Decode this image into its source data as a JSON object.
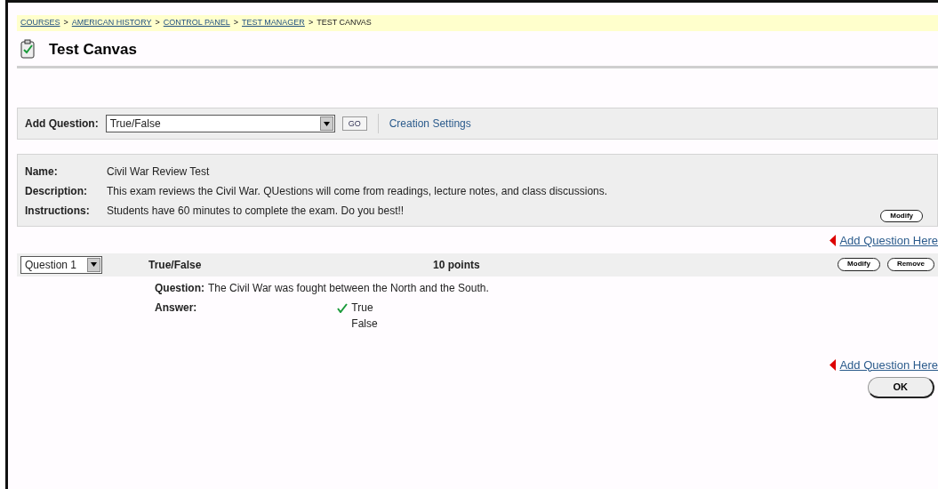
{
  "breadcrumb": {
    "separator": ">",
    "items": [
      {
        "label": "COURSES",
        "link": true
      },
      {
        "label": "AMERICAN HISTORY",
        "link": true
      },
      {
        "label": "CONTROL PANEL",
        "link": true
      },
      {
        "label": "TEST MANAGER",
        "link": true
      },
      {
        "label": "TEST CANVAS",
        "link": false
      }
    ]
  },
  "page_title": "Test Canvas",
  "add_question": {
    "label": "Add Question:",
    "value": "True/False",
    "go": "GO",
    "settings_link": "Creation Settings"
  },
  "test_info": {
    "fields": [
      {
        "label": "Name:",
        "value": "Civil War Review Test"
      },
      {
        "label": "Description:",
        "value": "This exam reviews the Civil War. QUestions will come from readings, lecture notes, and class discussions."
      },
      {
        "label": "Instructions:",
        "value": "Students have 60 minutes to complete the exam. Do you best!!"
      }
    ],
    "modify": "Modify"
  },
  "add_here_top": "Add Question Here",
  "questions": [
    {
      "number": "Question 1",
      "type": "True/False",
      "points": "10 points",
      "modify": "Modify",
      "remove": "Remove",
      "question_label": "Question:",
      "question_text": "The Civil War was fought between the North and the South.",
      "answer_label": "Answer:",
      "answers": [
        {
          "text": "True",
          "correct": true
        },
        {
          "text": "False",
          "correct": false
        }
      ]
    }
  ],
  "add_here_bottom": "Add Question Here",
  "ok": "OK"
}
